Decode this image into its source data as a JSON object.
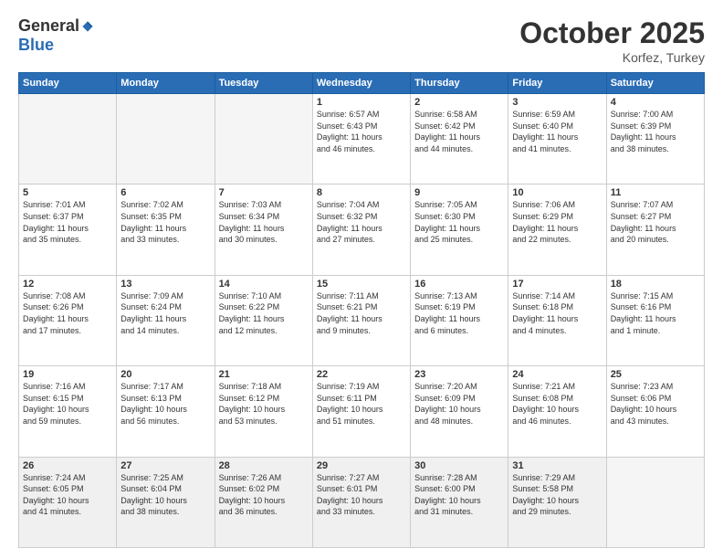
{
  "header": {
    "logo_general": "General",
    "logo_blue": "Blue",
    "month": "October 2025",
    "location": "Korfez, Turkey"
  },
  "days_of_week": [
    "Sunday",
    "Monday",
    "Tuesday",
    "Wednesday",
    "Thursday",
    "Friday",
    "Saturday"
  ],
  "weeks": [
    [
      {
        "day": "",
        "info": ""
      },
      {
        "day": "",
        "info": ""
      },
      {
        "day": "",
        "info": ""
      },
      {
        "day": "1",
        "info": "Sunrise: 6:57 AM\nSunset: 6:43 PM\nDaylight: 11 hours\nand 46 minutes."
      },
      {
        "day": "2",
        "info": "Sunrise: 6:58 AM\nSunset: 6:42 PM\nDaylight: 11 hours\nand 44 minutes."
      },
      {
        "day": "3",
        "info": "Sunrise: 6:59 AM\nSunset: 6:40 PM\nDaylight: 11 hours\nand 41 minutes."
      },
      {
        "day": "4",
        "info": "Sunrise: 7:00 AM\nSunset: 6:39 PM\nDaylight: 11 hours\nand 38 minutes."
      }
    ],
    [
      {
        "day": "5",
        "info": "Sunrise: 7:01 AM\nSunset: 6:37 PM\nDaylight: 11 hours\nand 35 minutes."
      },
      {
        "day": "6",
        "info": "Sunrise: 7:02 AM\nSunset: 6:35 PM\nDaylight: 11 hours\nand 33 minutes."
      },
      {
        "day": "7",
        "info": "Sunrise: 7:03 AM\nSunset: 6:34 PM\nDaylight: 11 hours\nand 30 minutes."
      },
      {
        "day": "8",
        "info": "Sunrise: 7:04 AM\nSunset: 6:32 PM\nDaylight: 11 hours\nand 27 minutes."
      },
      {
        "day": "9",
        "info": "Sunrise: 7:05 AM\nSunset: 6:30 PM\nDaylight: 11 hours\nand 25 minutes."
      },
      {
        "day": "10",
        "info": "Sunrise: 7:06 AM\nSunset: 6:29 PM\nDaylight: 11 hours\nand 22 minutes."
      },
      {
        "day": "11",
        "info": "Sunrise: 7:07 AM\nSunset: 6:27 PM\nDaylight: 11 hours\nand 20 minutes."
      }
    ],
    [
      {
        "day": "12",
        "info": "Sunrise: 7:08 AM\nSunset: 6:26 PM\nDaylight: 11 hours\nand 17 minutes."
      },
      {
        "day": "13",
        "info": "Sunrise: 7:09 AM\nSunset: 6:24 PM\nDaylight: 11 hours\nand 14 minutes."
      },
      {
        "day": "14",
        "info": "Sunrise: 7:10 AM\nSunset: 6:22 PM\nDaylight: 11 hours\nand 12 minutes."
      },
      {
        "day": "15",
        "info": "Sunrise: 7:11 AM\nSunset: 6:21 PM\nDaylight: 11 hours\nand 9 minutes."
      },
      {
        "day": "16",
        "info": "Sunrise: 7:13 AM\nSunset: 6:19 PM\nDaylight: 11 hours\nand 6 minutes."
      },
      {
        "day": "17",
        "info": "Sunrise: 7:14 AM\nSunset: 6:18 PM\nDaylight: 11 hours\nand 4 minutes."
      },
      {
        "day": "18",
        "info": "Sunrise: 7:15 AM\nSunset: 6:16 PM\nDaylight: 11 hours\nand 1 minute."
      }
    ],
    [
      {
        "day": "19",
        "info": "Sunrise: 7:16 AM\nSunset: 6:15 PM\nDaylight: 10 hours\nand 59 minutes."
      },
      {
        "day": "20",
        "info": "Sunrise: 7:17 AM\nSunset: 6:13 PM\nDaylight: 10 hours\nand 56 minutes."
      },
      {
        "day": "21",
        "info": "Sunrise: 7:18 AM\nSunset: 6:12 PM\nDaylight: 10 hours\nand 53 minutes."
      },
      {
        "day": "22",
        "info": "Sunrise: 7:19 AM\nSunset: 6:11 PM\nDaylight: 10 hours\nand 51 minutes."
      },
      {
        "day": "23",
        "info": "Sunrise: 7:20 AM\nSunset: 6:09 PM\nDaylight: 10 hours\nand 48 minutes."
      },
      {
        "day": "24",
        "info": "Sunrise: 7:21 AM\nSunset: 6:08 PM\nDaylight: 10 hours\nand 46 minutes."
      },
      {
        "day": "25",
        "info": "Sunrise: 7:23 AM\nSunset: 6:06 PM\nDaylight: 10 hours\nand 43 minutes."
      }
    ],
    [
      {
        "day": "26",
        "info": "Sunrise: 7:24 AM\nSunset: 6:05 PM\nDaylight: 10 hours\nand 41 minutes."
      },
      {
        "day": "27",
        "info": "Sunrise: 7:25 AM\nSunset: 6:04 PM\nDaylight: 10 hours\nand 38 minutes."
      },
      {
        "day": "28",
        "info": "Sunrise: 7:26 AM\nSunset: 6:02 PM\nDaylight: 10 hours\nand 36 minutes."
      },
      {
        "day": "29",
        "info": "Sunrise: 7:27 AM\nSunset: 6:01 PM\nDaylight: 10 hours\nand 33 minutes."
      },
      {
        "day": "30",
        "info": "Sunrise: 7:28 AM\nSunset: 6:00 PM\nDaylight: 10 hours\nand 31 minutes."
      },
      {
        "day": "31",
        "info": "Sunrise: 7:29 AM\nSunset: 5:58 PM\nDaylight: 10 hours\nand 29 minutes."
      },
      {
        "day": "",
        "info": ""
      }
    ]
  ]
}
